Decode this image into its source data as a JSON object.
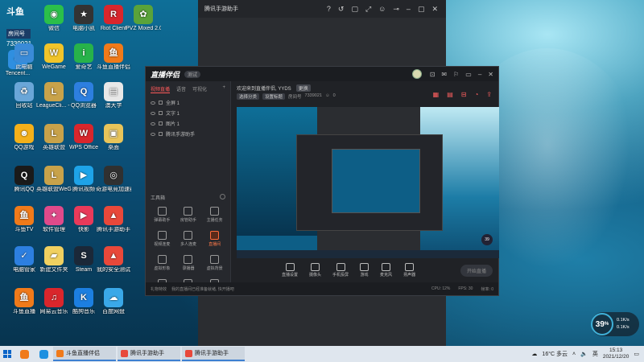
{
  "overlay": {
    "logo": "斗鱼",
    "room_label": "房间号",
    "room_number": "7339021"
  },
  "desktop_icons": [
    {
      "label": "Tencent...",
      "color": "#2f8fe0",
      "glyph": "✈"
    },
    {
      "label": "微信",
      "color": "#2bbf4a",
      "glyph": "◉"
    },
    {
      "label": "电脑小凯",
      "color": "#333333",
      "glyph": "★"
    },
    {
      "label": "Riot Client",
      "color": "#d9262c",
      "glyph": "R"
    },
    {
      "label": "PVZ Mixed 2.05 RTM...",
      "color": "#5aa33a",
      "glyph": "✿"
    },
    {
      "label": "此电脑",
      "color": "#3a8bd8",
      "glyph": "▭"
    },
    {
      "label": "WeGame",
      "color": "#f0c42a",
      "glyph": "W"
    },
    {
      "label": "爱奇艺",
      "color": "#27b24a",
      "glyph": "i"
    },
    {
      "label": "斗鱼直播伴侣",
      "color": "#f07a1a",
      "glyph": "鱼"
    },
    {
      "label": "回收站",
      "color": "#6aa6d8",
      "glyph": "♻"
    },
    {
      "label": "LeagueCli... - 快捷方式",
      "color": "#c8a24a",
      "glyph": "L"
    },
    {
      "label": "QQ浏览器",
      "color": "#2d7fe0",
      "glyph": "Q"
    },
    {
      "label": "澳大学",
      "color": "#e8e8e8",
      "glyph": "▤"
    },
    {
      "label": "QQ游戏",
      "color": "#f4b01a",
      "glyph": "☻"
    },
    {
      "label": "英雄联盟",
      "color": "#c8a24a",
      "glyph": "L"
    },
    {
      "label": "WPS Office",
      "color": "#d9262c",
      "glyph": "W"
    },
    {
      "label": "桌面",
      "color": "#e8c45a",
      "glyph": "▣"
    },
    {
      "label": "腾讯QQ",
      "color": "#1a1a1a",
      "glyph": "Q"
    },
    {
      "label": "英雄联盟WeGame版",
      "color": "#c8a24a",
      "glyph": "L"
    },
    {
      "label": "腾讯视频",
      "color": "#1ea3e8",
      "glyph": "▶"
    },
    {
      "label": "奇游电竞加速器",
      "color": "#303030",
      "glyph": "◎"
    },
    {
      "label": "斗鱼TV",
      "color": "#f07a1a",
      "glyph": "鱼"
    },
    {
      "label": "软件管理",
      "color": "#e04a8a",
      "glyph": "✦"
    },
    {
      "label": "快影",
      "color": "#e83a5a",
      "glyph": "▶"
    },
    {
      "label": "腾讯手游助手",
      "color": "#e8483a",
      "glyph": "▲"
    },
    {
      "label": "电脑管家",
      "color": "#2d7fe0",
      "glyph": "✓"
    },
    {
      "label": "新建文件夹",
      "color": "#f0d060",
      "glyph": "▰"
    },
    {
      "label": "Steam",
      "color": "#1b2838",
      "glyph": "S"
    },
    {
      "label": "我的安全测试",
      "color": "#e8483a",
      "glyph": "▲"
    },
    {
      "label": "斗鱼直播",
      "color": "#f07a1a",
      "glyph": "鱼"
    },
    {
      "label": "网易云音乐",
      "color": "#d9262c",
      "glyph": "♫"
    },
    {
      "label": "酷狗音乐",
      "color": "#1c7fe0",
      "glyph": "K"
    },
    {
      "label": "百度网盘",
      "color": "#3aa8e8",
      "glyph": "☁"
    }
  ],
  "bg_window": {
    "title": "腾讯手游助手",
    "controls": [
      "?",
      "↺",
      "▢",
      "⤢",
      "☺",
      "⊸",
      "–",
      "▢",
      "✕"
    ]
  },
  "main_window": {
    "brand": "直播伴侣",
    "version": "测试",
    "titlebar_icons": [
      "⊡",
      "✉",
      "⚐",
      "▭",
      "–",
      "✕"
    ],
    "tabs": [
      {
        "label": "视频直播",
        "active": true
      },
      {
        "label": "语音",
        "active": false
      },
      {
        "label": "可视化",
        "active": false
      }
    ],
    "add_tab": "+",
    "scenes": [
      "全屏 1",
      "文字 1",
      "图片 1",
      "腾讯手游助手"
    ],
    "tools_label": "工具箱",
    "tools": [
      {
        "label": "弹幕助手",
        "hot": false
      },
      {
        "label": "房管助手",
        "hot": false
      },
      {
        "label": "主播任务",
        "hot": false
      },
      {
        "label": "视频连麦",
        "hot": false
      },
      {
        "label": "多人连麦",
        "hot": false
      },
      {
        "label": "直播间",
        "hot": true
      },
      {
        "label": "虚拟形象",
        "hot": false
      },
      {
        "label": "录播器",
        "hot": false
      },
      {
        "label": "虚拟背景",
        "hot": false
      },
      {
        "label": "自动剪辑",
        "hot": false
      },
      {
        "label": "下载",
        "hot": false
      },
      {
        "label": "更多",
        "hot": false
      }
    ],
    "greeting": "欢迎来到直播伴侣, YYDS",
    "greeting_tag": "更换",
    "stream_tags": [
      "选择分类",
      "设置标题"
    ],
    "room_prefix": "房间号",
    "room_number": "7339021",
    "viewers": "0",
    "top_icons": [
      "▦",
      "▤",
      "⊟",
      "◔",
      "⇪"
    ],
    "controls": [
      {
        "label": "直播设置"
      },
      {
        "label": "摄像头"
      },
      {
        "label": "手机投屏"
      },
      {
        "label": "游戏"
      },
      {
        "label": "麦克风"
      },
      {
        "label": "扬声器"
      }
    ],
    "start_button": "开始直播",
    "status_left": "礼物特效",
    "status_text": "我的直播间已经准备就绪, 快开播吧",
    "status_right": [
      "CPU: 12%",
      "FPS: 30",
      "帧率: 0"
    ]
  },
  "network": {
    "percent": "39",
    "unit": "%",
    "up": "0.1K/s",
    "down": "0.1K/s"
  },
  "taskbar": {
    "tasks": [
      {
        "label": "斗鱼直播伴侣",
        "color": "#f07a1a"
      },
      {
        "label": "腾讯手游助手",
        "color": "#e8483a"
      },
      {
        "label": "腾讯手游助手",
        "color": "#e8483a"
      }
    ],
    "weather": "16°C 多云",
    "ime": "英",
    "time": "15:13",
    "date": "2021/12/20"
  }
}
